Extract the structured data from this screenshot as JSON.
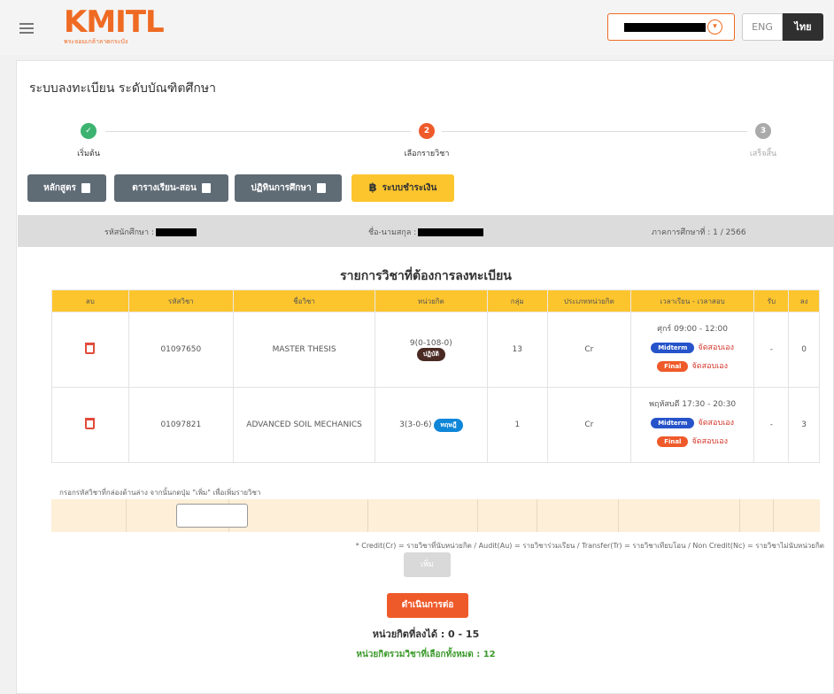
{
  "header": {
    "logo": "KMITL",
    "logo_sub": "พระจอมเกล้าลาดกระบัง",
    "lang_eng": "ENG",
    "lang_thai": "ไทย"
  },
  "page_title": "ระบบลงทะเบียน ระดับบัณฑิตศึกษา",
  "steps": [
    {
      "label": "เริ่มต้น",
      "number": "✓",
      "color": "#3cb371"
    },
    {
      "label": "เลือกรายวิชา",
      "number": "2",
      "color": "#ef5a2a"
    },
    {
      "label": "เสร็จสิ้น",
      "number": "3",
      "color": "#aaaaaa"
    }
  ],
  "buttons": {
    "curriculum": "หลักสูตร",
    "timetable": "ตารางเรียน-สอน",
    "calendar": "ปฏิทินการศึกษา",
    "payment": "ระบบชำระเงิน"
  },
  "info": {
    "student_id_label": "รหัสนักศึกษา :",
    "name_label": "ชื่อ-นามสกุล :",
    "semester": "ภาคการศึกษาที่ : 1 / 2566"
  },
  "table_title": "รายการวิชาที่ต้องการลงทะเบียน",
  "columns": [
    "ลบ",
    "รหัสวิชา",
    "ชื่อวิชา",
    "หน่วยกิต",
    "กลุ่ม",
    "ประเภทหน่วยกิต",
    "เวลาเรียน - เวลาสอบ",
    "รับ",
    "ลง"
  ],
  "rows": [
    {
      "code": "01097650",
      "name": "MASTER THESIS",
      "credit": "9(0-108-0)",
      "credit_badge": "ปฏิบัติ",
      "group": "13",
      "type": "Cr",
      "time": "ศุกร์ 09:00 - 12:00",
      "midterm_label": "Midterm",
      "midterm_text": "จัดสอบเอง",
      "final_label": "Final",
      "final_text": "จัดสอบเอง",
      "accept": "-",
      "enrolled": "0"
    },
    {
      "code": "01097821",
      "name": "ADVANCED SOIL MECHANICS",
      "credit": "3(3-0-6)",
      "credit_badge": "ทฤษฎี",
      "group": "1",
      "type": "Cr",
      "time": "พฤหัสบดี 17:30 - 20:30",
      "midterm_label": "Midterm",
      "midterm_text": "จัดสอบเอง",
      "final_label": "Final",
      "final_text": "จัดสอบเอง",
      "accept": "-",
      "enrolled": "3"
    }
  ],
  "instruction": "กรอกรหัสวิชาที่กล่องด้านล่าง จากนั้นกดปุ่ม \"เพิ่ม\" เพื่อเพิ่มรายวิชา",
  "legend": "* Credit(Cr) = รายวิชาที่นับหน่วยกิต / Audit(Au) = รายวิชาร่วมเรียน / Transfer(Tr) = รายวิชาเทียบโอน / Non Credit(Nc) = รายวิชาไม่นับหน่วยกิต",
  "add_button": "เพิ่ม",
  "next_button": "ดำเนินการต่อ",
  "credits_allowed": "หน่วยกิตที่ลงได้ : 0 - 15",
  "credits_total": "หน่วยกิตรวมวิชาที่เลือกทั้งหมด : 12"
}
